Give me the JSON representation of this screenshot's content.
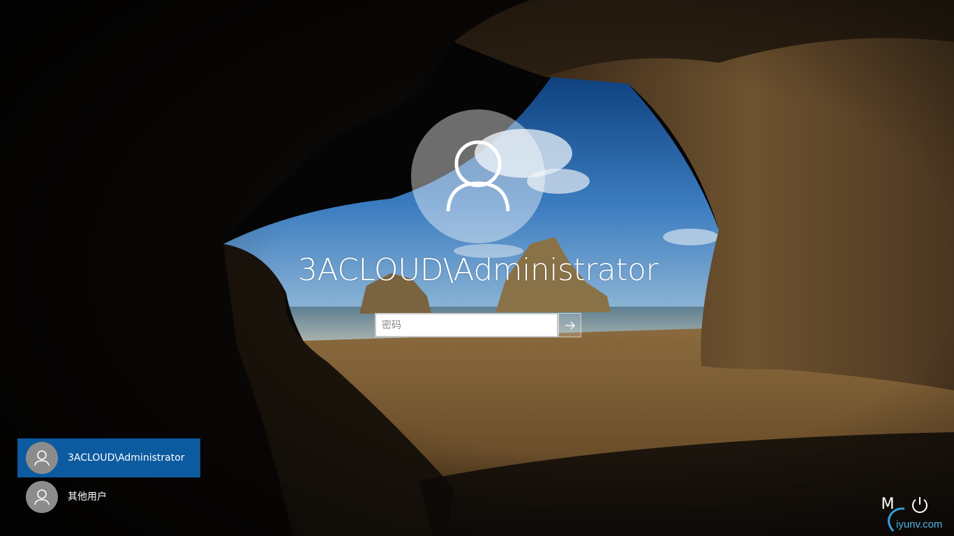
{
  "login": {
    "username": "3ACLOUD\\Administrator",
    "password_placeholder": "密码",
    "submit_icon": "arrow-right-icon"
  },
  "user_list": [
    {
      "label": "3ACLOUD\\Administrator",
      "selected": true,
      "icon": "user-avatar-icon"
    },
    {
      "label": "其他用户",
      "selected": false,
      "icon": "user-avatar-icon"
    }
  ],
  "tray": {
    "ime_label": "M",
    "power_icon": "power-icon"
  },
  "watermark": {
    "text": "iyunv.com"
  },
  "colors": {
    "selected_user_bg": "#0c5aa0",
    "avatar_circle": "#8c8c8c"
  }
}
